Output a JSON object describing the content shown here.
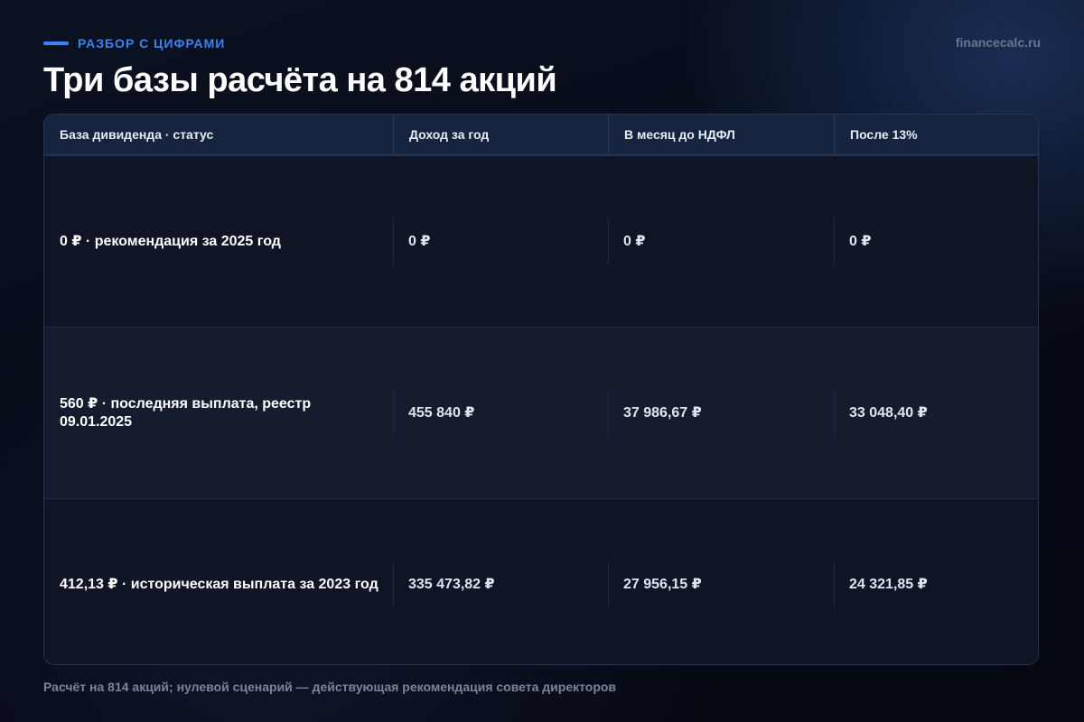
{
  "header": {
    "eyebrow": "РАЗБОР С ЦИФРАМИ",
    "site": "financecalc.ru",
    "title": "Три базы расчёта на 814 акций",
    "accent_color": "#3b82f6"
  },
  "table": {
    "columns": [
      "База дивиденда · статус",
      "Доход за год",
      "В месяц до НДФЛ",
      "После 13%"
    ],
    "rows": [
      {
        "base": "0 ₽ · рекомендация за 2025 год",
        "year": "0 ₽",
        "month": "0 ₽",
        "after_tax": "0 ₽"
      },
      {
        "base": "560 ₽ · последняя выплата, реестр 09.01.2025",
        "year": "455 840 ₽",
        "month": "37 986,67 ₽",
        "after_tax": "33 048,40 ₽"
      },
      {
        "base": "412,13 ₽ · историческая выплата за 2023 год",
        "year": "335 473,82 ₽",
        "month": "27 956,15 ₽",
        "after_tax": "24 321,85 ₽"
      }
    ]
  },
  "footnote": "Расчёт на 814 акций; нулевой сценарий — действующая рекомендация совета директоров"
}
